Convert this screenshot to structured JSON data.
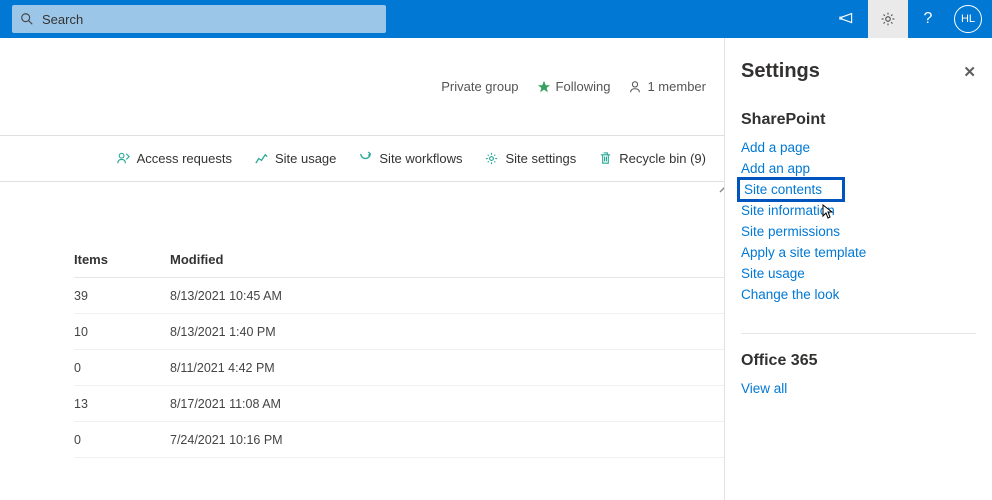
{
  "search": {
    "placeholder": "Search"
  },
  "avatar_initials": "HL",
  "site": {
    "privacy": "Private group",
    "following": "Following",
    "members": "1 member"
  },
  "actions": {
    "access_requests": "Access requests",
    "site_usage": "Site usage",
    "site_workflows": "Site workflows",
    "site_settings": "Site settings",
    "recycle_bin": "Recycle bin (9)"
  },
  "columns": {
    "items": "Items",
    "modified": "Modified"
  },
  "rows": [
    {
      "items": "39",
      "modified": "8/13/2021 10:45 AM"
    },
    {
      "items": "10",
      "modified": "8/13/2021 1:40 PM"
    },
    {
      "items": "0",
      "modified": "8/11/2021 4:42 PM"
    },
    {
      "items": "13",
      "modified": "8/17/2021 11:08 AM"
    },
    {
      "items": "0",
      "modified": "7/24/2021 10:16 PM"
    }
  ],
  "panel": {
    "title": "Settings",
    "sharepoint_heading": "SharePoint",
    "links": [
      "Add a page",
      "Add an app",
      "Site contents",
      "Site information",
      "Site permissions",
      "Apply a site template",
      "Site usage",
      "Change the look"
    ],
    "highlight_index": 2,
    "office_heading": "Office 365",
    "view_all": "View all"
  }
}
